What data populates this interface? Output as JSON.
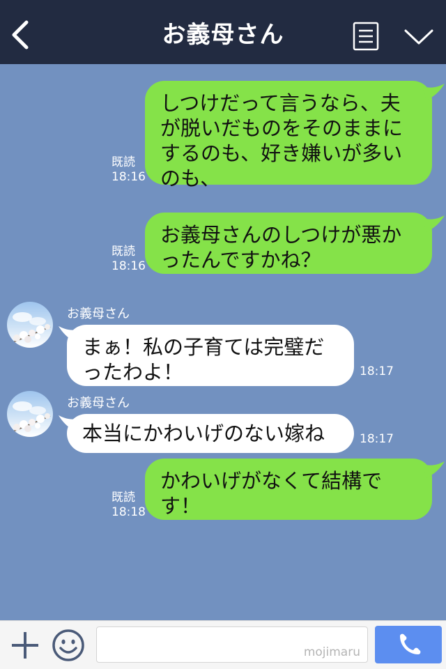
{
  "header": {
    "title": "お義母さん"
  },
  "messages": [
    {
      "dir": "out",
      "text": "しつけだって言うなら、夫が脱いだものをそのままにするのも、好き嫌いが多いのも、",
      "read": "既読",
      "time": "18:16"
    },
    {
      "dir": "out",
      "text": "お義母さんのしつけが悪かったんですかね？",
      "read": "既読",
      "time": "18:16"
    },
    {
      "dir": "in",
      "sender": "お義母さん",
      "text": "まぁ！私の子育ては完璧だったわよ！",
      "time": "18:17"
    },
    {
      "dir": "in",
      "sender": "お義母さん",
      "text": "本当にかわいげのない嫁ね",
      "time": "18:17"
    },
    {
      "dir": "out",
      "text": "かわいげがなくて結構です！",
      "read": "既読",
      "time": "18:18"
    }
  ],
  "footer": {
    "watermark": "mojimaru"
  },
  "colors": {
    "background": "#7291c0",
    "header": "#222b41",
    "outgoing_bubble": "#85e249",
    "incoming_bubble": "#ffffff",
    "call_button": "#5c8ef0"
  },
  "icons": {
    "back": "chevron-left-icon",
    "menu": "list-icon",
    "collapse": "chevron-down-icon",
    "plus": "plus-icon",
    "emoji": "smiley-icon",
    "call": "phone-icon"
  }
}
